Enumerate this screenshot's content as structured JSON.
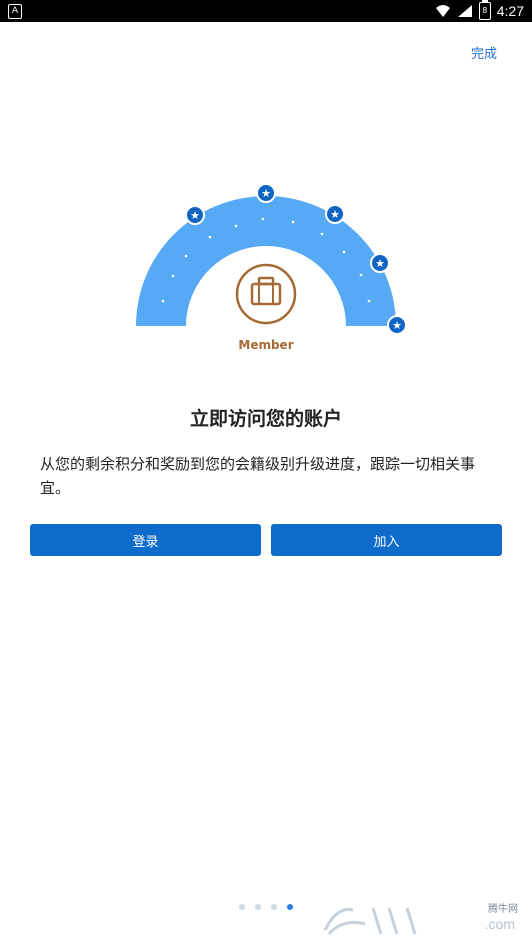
{
  "status_bar": {
    "time": "4:27",
    "app_icon_label": "A",
    "battery_label": "8",
    "icons": [
      "wifi-icon",
      "signal-icon",
      "battery-icon"
    ]
  },
  "header": {
    "done_label": "完成"
  },
  "illustration": {
    "badge_label": "Member"
  },
  "main": {
    "title": "立即访问您的账户",
    "description": "从您的剩余积分和奖励到您的会籍级别升级进度，跟踪一切相关事宜。"
  },
  "buttons": {
    "login_label": "登录",
    "join_label": "加入"
  },
  "pagination": {
    "total": 4,
    "active_index": 3
  },
  "watermark": {
    "site_label": "腾牛网",
    "domain_suffix": ".com"
  },
  "colors": {
    "accent": "#0f6ccb",
    "arc": "#56a9f5",
    "bronze": "#a66a35",
    "text": "#222222"
  }
}
